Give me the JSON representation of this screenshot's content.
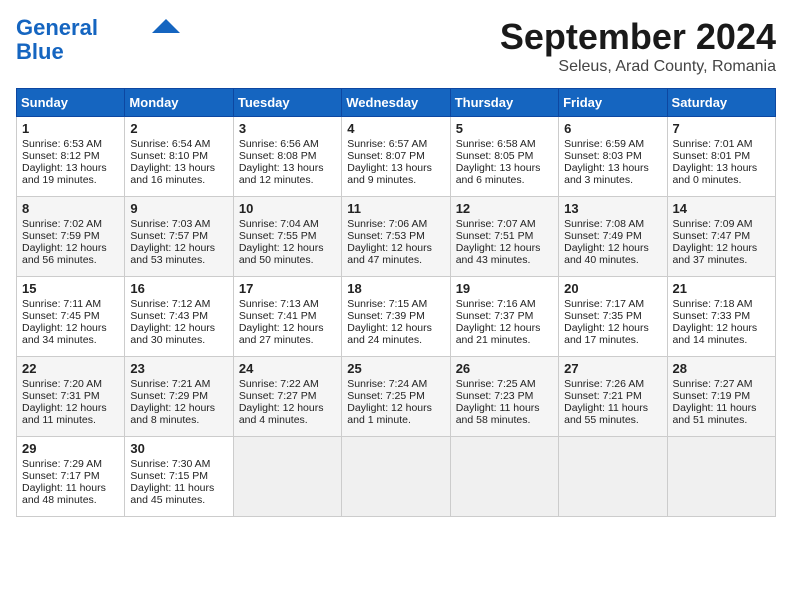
{
  "header": {
    "logo_line1": "General",
    "logo_line2": "Blue",
    "month_title": "September 2024",
    "location": "Seleus, Arad County, Romania"
  },
  "weekdays": [
    "Sunday",
    "Monday",
    "Tuesday",
    "Wednesday",
    "Thursday",
    "Friday",
    "Saturday"
  ],
  "rows": [
    [
      {
        "day": "1",
        "lines": [
          "Sunrise: 6:53 AM",
          "Sunset: 8:12 PM",
          "Daylight: 13 hours",
          "and 19 minutes."
        ]
      },
      {
        "day": "2",
        "lines": [
          "Sunrise: 6:54 AM",
          "Sunset: 8:10 PM",
          "Daylight: 13 hours",
          "and 16 minutes."
        ]
      },
      {
        "day": "3",
        "lines": [
          "Sunrise: 6:56 AM",
          "Sunset: 8:08 PM",
          "Daylight: 13 hours",
          "and 12 minutes."
        ]
      },
      {
        "day": "4",
        "lines": [
          "Sunrise: 6:57 AM",
          "Sunset: 8:07 PM",
          "Daylight: 13 hours",
          "and 9 minutes."
        ]
      },
      {
        "day": "5",
        "lines": [
          "Sunrise: 6:58 AM",
          "Sunset: 8:05 PM",
          "Daylight: 13 hours",
          "and 6 minutes."
        ]
      },
      {
        "day": "6",
        "lines": [
          "Sunrise: 6:59 AM",
          "Sunset: 8:03 PM",
          "Daylight: 13 hours",
          "and 3 minutes."
        ]
      },
      {
        "day": "7",
        "lines": [
          "Sunrise: 7:01 AM",
          "Sunset: 8:01 PM",
          "Daylight: 13 hours",
          "and 0 minutes."
        ]
      }
    ],
    [
      {
        "day": "8",
        "lines": [
          "Sunrise: 7:02 AM",
          "Sunset: 7:59 PM",
          "Daylight: 12 hours",
          "and 56 minutes."
        ]
      },
      {
        "day": "9",
        "lines": [
          "Sunrise: 7:03 AM",
          "Sunset: 7:57 PM",
          "Daylight: 12 hours",
          "and 53 minutes."
        ]
      },
      {
        "day": "10",
        "lines": [
          "Sunrise: 7:04 AM",
          "Sunset: 7:55 PM",
          "Daylight: 12 hours",
          "and 50 minutes."
        ]
      },
      {
        "day": "11",
        "lines": [
          "Sunrise: 7:06 AM",
          "Sunset: 7:53 PM",
          "Daylight: 12 hours",
          "and 47 minutes."
        ]
      },
      {
        "day": "12",
        "lines": [
          "Sunrise: 7:07 AM",
          "Sunset: 7:51 PM",
          "Daylight: 12 hours",
          "and 43 minutes."
        ]
      },
      {
        "day": "13",
        "lines": [
          "Sunrise: 7:08 AM",
          "Sunset: 7:49 PM",
          "Daylight: 12 hours",
          "and 40 minutes."
        ]
      },
      {
        "day": "14",
        "lines": [
          "Sunrise: 7:09 AM",
          "Sunset: 7:47 PM",
          "Daylight: 12 hours",
          "and 37 minutes."
        ]
      }
    ],
    [
      {
        "day": "15",
        "lines": [
          "Sunrise: 7:11 AM",
          "Sunset: 7:45 PM",
          "Daylight: 12 hours",
          "and 34 minutes."
        ]
      },
      {
        "day": "16",
        "lines": [
          "Sunrise: 7:12 AM",
          "Sunset: 7:43 PM",
          "Daylight: 12 hours",
          "and 30 minutes."
        ]
      },
      {
        "day": "17",
        "lines": [
          "Sunrise: 7:13 AM",
          "Sunset: 7:41 PM",
          "Daylight: 12 hours",
          "and 27 minutes."
        ]
      },
      {
        "day": "18",
        "lines": [
          "Sunrise: 7:15 AM",
          "Sunset: 7:39 PM",
          "Daylight: 12 hours",
          "and 24 minutes."
        ]
      },
      {
        "day": "19",
        "lines": [
          "Sunrise: 7:16 AM",
          "Sunset: 7:37 PM",
          "Daylight: 12 hours",
          "and 21 minutes."
        ]
      },
      {
        "day": "20",
        "lines": [
          "Sunrise: 7:17 AM",
          "Sunset: 7:35 PM",
          "Daylight: 12 hours",
          "and 17 minutes."
        ]
      },
      {
        "day": "21",
        "lines": [
          "Sunrise: 7:18 AM",
          "Sunset: 7:33 PM",
          "Daylight: 12 hours",
          "and 14 minutes."
        ]
      }
    ],
    [
      {
        "day": "22",
        "lines": [
          "Sunrise: 7:20 AM",
          "Sunset: 7:31 PM",
          "Daylight: 12 hours",
          "and 11 minutes."
        ]
      },
      {
        "day": "23",
        "lines": [
          "Sunrise: 7:21 AM",
          "Sunset: 7:29 PM",
          "Daylight: 12 hours",
          "and 8 minutes."
        ]
      },
      {
        "day": "24",
        "lines": [
          "Sunrise: 7:22 AM",
          "Sunset: 7:27 PM",
          "Daylight: 12 hours",
          "and 4 minutes."
        ]
      },
      {
        "day": "25",
        "lines": [
          "Sunrise: 7:24 AM",
          "Sunset: 7:25 PM",
          "Daylight: 12 hours",
          "and 1 minute."
        ]
      },
      {
        "day": "26",
        "lines": [
          "Sunrise: 7:25 AM",
          "Sunset: 7:23 PM",
          "Daylight: 11 hours",
          "and 58 minutes."
        ]
      },
      {
        "day": "27",
        "lines": [
          "Sunrise: 7:26 AM",
          "Sunset: 7:21 PM",
          "Daylight: 11 hours",
          "and 55 minutes."
        ]
      },
      {
        "day": "28",
        "lines": [
          "Sunrise: 7:27 AM",
          "Sunset: 7:19 PM",
          "Daylight: 11 hours",
          "and 51 minutes."
        ]
      }
    ],
    [
      {
        "day": "29",
        "lines": [
          "Sunrise: 7:29 AM",
          "Sunset: 7:17 PM",
          "Daylight: 11 hours",
          "and 48 minutes."
        ]
      },
      {
        "day": "30",
        "lines": [
          "Sunrise: 7:30 AM",
          "Sunset: 7:15 PM",
          "Daylight: 11 hours",
          "and 45 minutes."
        ]
      },
      {
        "day": "",
        "lines": []
      },
      {
        "day": "",
        "lines": []
      },
      {
        "day": "",
        "lines": []
      },
      {
        "day": "",
        "lines": []
      },
      {
        "day": "",
        "lines": []
      }
    ]
  ]
}
